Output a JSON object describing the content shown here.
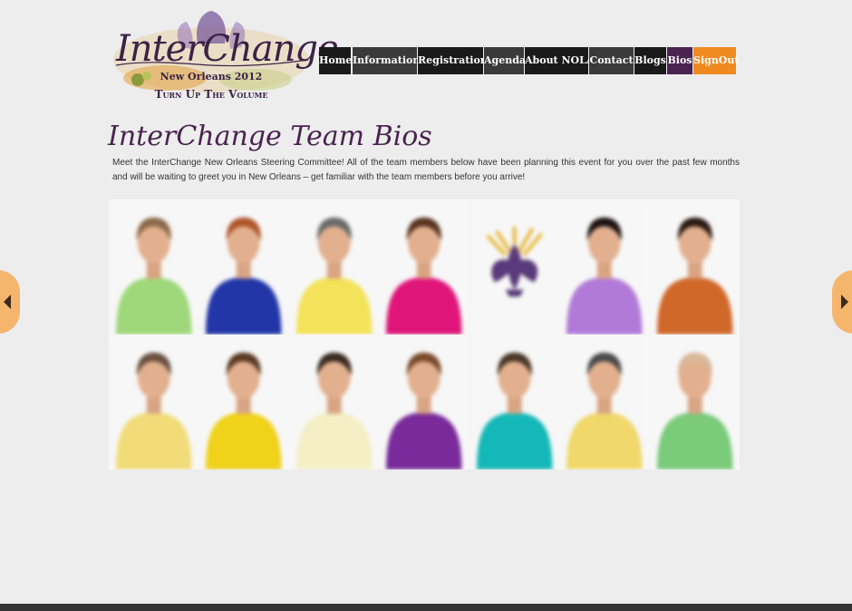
{
  "logo": {
    "title": "InterChange",
    "subtitle": "New Orleans 2012",
    "tagline": "Turn Up The Volume"
  },
  "nav": {
    "items": [
      {
        "label": "Home"
      },
      {
        "label": "Information"
      },
      {
        "label": "Registration"
      },
      {
        "label": "Agenda"
      },
      {
        "label": "About NOLA"
      },
      {
        "label": "Contact"
      },
      {
        "label": "Blogs"
      },
      {
        "label": "Bios"
      },
      {
        "label": "SignOut"
      }
    ],
    "active": "Bios"
  },
  "page": {
    "title": "InterChange Team Bios",
    "intro": "Meet the InterChange New Orleans Steering Committee! All of the team members below have been planning this event for you over the past few months and will be waiting to greet you in New Orleans – get familiar with the team members before you arrive!"
  },
  "colors": {
    "brand_purple": "#4a2350",
    "signout_orange": "#ef8a21",
    "arrow_orange": "#f5b56c",
    "nav_dark": "#1a1a1a"
  },
  "carousel": {
    "prev_icon": "chevron-left-icon",
    "next_icon": "chevron-right-icon"
  },
  "photos": [
    {
      "kind": "person",
      "shirt": "#9fd87a",
      "hair": "#8a6a4a"
    },
    {
      "kind": "person",
      "shirt": "#2236a8",
      "hair": "#b0552a"
    },
    {
      "kind": "person",
      "shirt": "#f3e35a",
      "hair": "#6a6a6a"
    },
    {
      "kind": "person",
      "shirt": "#e0157a",
      "hair": "#5a3420"
    },
    {
      "kind": "logo",
      "shirt": "#5a3a7a",
      "hair": "#e8b83a"
    },
    {
      "kind": "person",
      "shirt": "#b27ad8",
      "hair": "#1c1412"
    },
    {
      "kind": "person",
      "shirt": "#d0682a",
      "hair": "#2a1a12"
    },
    {
      "kind": "person",
      "shirt": "#f2dc7a",
      "hair": "#6a5040"
    },
    {
      "kind": "person",
      "shirt": "#f0d21a",
      "hair": "#5a3a24"
    },
    {
      "kind": "person",
      "shirt": "#f4efc4",
      "hair": "#3a2a20"
    },
    {
      "kind": "person",
      "shirt": "#7a2a9a",
      "hair": "#7a4a2a"
    },
    {
      "kind": "person",
      "shirt": "#15b8b8",
      "hair": "#4a3626"
    },
    {
      "kind": "person",
      "shirt": "#f0d86a",
      "hair": "#4a4a4a"
    },
    {
      "kind": "person",
      "shirt": "#7acb7a",
      "hair": "#d9b89a"
    }
  ]
}
